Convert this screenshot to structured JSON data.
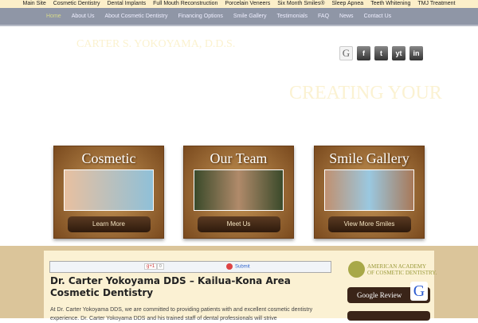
{
  "topbar": [
    "Main Site",
    "Cosmetic Dentistry",
    "Dental Implants",
    "Full Mouth Reconstruction",
    "Porcelain Veneers",
    "Six Month Smiles®",
    "Sleep Apnea",
    "Teeth Whitening",
    "TMJ Treatment"
  ],
  "nav": [
    "Home",
    "About Us",
    "About Cosmetic Dentistry",
    "Financing Options",
    "Smile Gallery",
    "Testimonials",
    "FAQ",
    "News",
    "Contact Us"
  ],
  "brand": "CARTER S. YOKOYAMA, D.D.S.",
  "social": [
    "G",
    "f",
    "t",
    "yt",
    "in"
  ],
  "tagline": "CREATING YOUR",
  "cards": [
    {
      "title": "Cosmetic",
      "button": "Learn More"
    },
    {
      "title": "Our Team",
      "button": "Meet Us"
    },
    {
      "title": "Smile Gallery",
      "button": "View More Smiles"
    }
  ],
  "share": {
    "gplus": "g+1",
    "count": "0",
    "submit": "Submit"
  },
  "article": {
    "title": "Dr. Carter Yokoyama DDS – Kailua-Kona Area Cosmetic Dentistry",
    "body": "At Dr. Carter Yokoyama DDS, we are committed to providing patients with and excellent cosmetic dentistry experience. Dr. Carter Yokoyama DDS and his trained staff of dental professionals will strive"
  },
  "sidebar": {
    "aacd1": "AMERICAN ACADEMY",
    "aacd2": "OF COSMETIC DENTISTRY.",
    "google_review": "Google Review",
    "google_icon": "G"
  }
}
